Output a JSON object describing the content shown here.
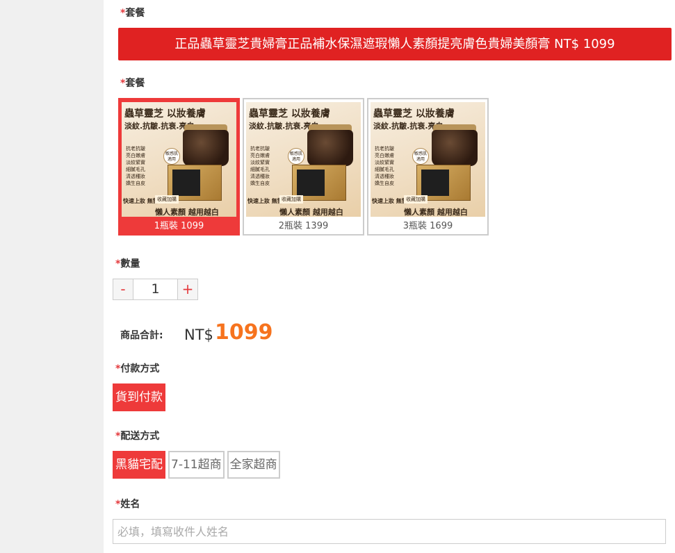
{
  "sections": {
    "package_label_1": "套餐",
    "package_label_2": "套餐",
    "quantity_label": "數量",
    "payment_label": "付款方式",
    "shipping_label": "配送方式",
    "name_label": "姓名",
    "required_mark": "*"
  },
  "banner": {
    "text": "正品蟲草靈芝貴婦膏正品補水保濕遮瑕懶人素顏提亮膚色貴婦美顏膏 NT$ 1099"
  },
  "packages": [
    {
      "caption": "1瓶裝 1099",
      "selected": true
    },
    {
      "caption": "2瓶裝 1399",
      "selected": false
    },
    {
      "caption": "3瓶裝 1699",
      "selected": false
    }
  ],
  "product_image": {
    "title": "蟲草靈芝 以妝養膚",
    "subtitle": "淡紋.抗皺.抗衰.亮白",
    "bullets": [
      "抗老抗皺",
      "亮白嫩膚",
      "淡紋緊實",
      "細膩毛孔",
      "清透種妝",
      "嬌生自皮"
    ],
    "badge": "敏感肌 適用",
    "tag_left": "快速上妝 無需卸妝",
    "tag_mid": "收藏加購",
    "slogan": "懶人素顏 越用越白"
  },
  "quantity": {
    "minus": "-",
    "value": "1",
    "plus": "+"
  },
  "total": {
    "label": "商品合計:",
    "currency": "NT$",
    "amount": "1099"
  },
  "payment": {
    "options": [
      "貨到付款"
    ]
  },
  "shipping": {
    "options": [
      "黑貓宅配",
      "7-11超商",
      "全家超商"
    ],
    "selected_index": 0
  },
  "name_field": {
    "placeholder": "必填，填寫收件人姓名",
    "value": ""
  },
  "colors": {
    "accent_red": "#e02222",
    "selected_red": "#ee3a3a",
    "price_orange": "#f6731e"
  }
}
